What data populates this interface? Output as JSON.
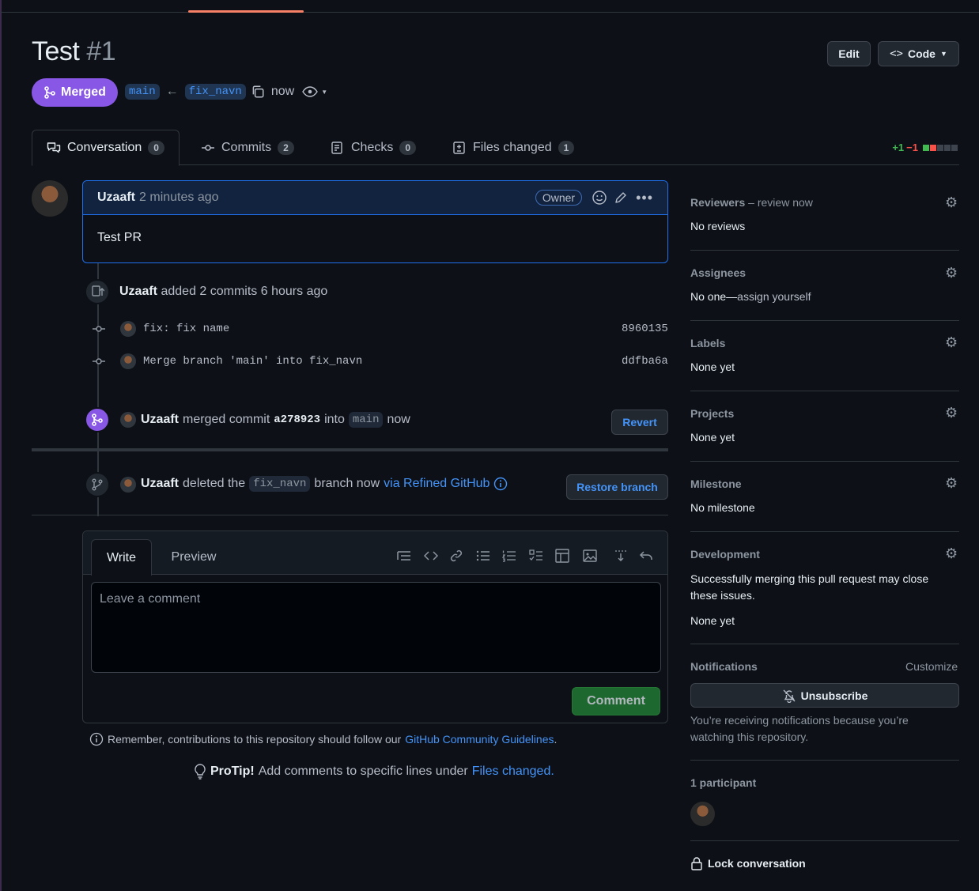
{
  "header": {
    "title": "Test",
    "number": "#1",
    "edit_label": "Edit",
    "code_label": "Code",
    "state_label": "Merged",
    "base_branch": "main",
    "arrow": "←",
    "head_branch": "fix_navn",
    "time": "now"
  },
  "tabs": [
    {
      "label": "Conversation",
      "count": "0"
    },
    {
      "label": "Commits",
      "count": "2"
    },
    {
      "label": "Checks",
      "count": "0"
    },
    {
      "label": "Files changed",
      "count": "1"
    }
  ],
  "diffstat": {
    "additions": "+1",
    "deletions": "−1"
  },
  "comment": {
    "author": "Uzaaft",
    "time": "2 minutes ago",
    "role": "Owner",
    "body": "Test PR"
  },
  "commits_event": {
    "author": "Uzaaft",
    "text": "added 2 commits 6 hours ago",
    "commits": [
      {
        "message": "fix: fix name",
        "sha": "8960135"
      },
      {
        "message": "Merge branch 'main' into fix_navn",
        "sha": "ddfba6a"
      }
    ]
  },
  "merge_event": {
    "author": "Uzaaft",
    "text1": "merged commit",
    "sha": "a278923",
    "text2": "into",
    "branch": "main",
    "time": "now",
    "revert_label": "Revert"
  },
  "delete_event": {
    "author": "Uzaaft",
    "text1": "deleted the",
    "branch": "fix_navn",
    "text2": "branch now",
    "via": "via Refined GitHub",
    "restore_label": "Restore branch"
  },
  "editor": {
    "write_label": "Write",
    "preview_label": "Preview",
    "placeholder": "Leave a comment",
    "submit_label": "Comment"
  },
  "footer": {
    "guidelines_prefix": "Remember, contributions to this repository should follow our",
    "guidelines_link": "GitHub Community Guidelines",
    "guidelines_suffix": ".",
    "protip_label": "ProTip!",
    "protip_text": "Add comments to specific lines under",
    "protip_link": "Files changed",
    "protip_suffix": "."
  },
  "sidebar": {
    "reviewers": {
      "title": "Reviewers",
      "extra": "– review now",
      "value": "No reviews"
    },
    "assignees": {
      "title": "Assignees",
      "value_prefix": "No one—",
      "value_link": "assign yourself"
    },
    "labels": {
      "title": "Labels",
      "value": "None yet"
    },
    "projects": {
      "title": "Projects",
      "value": "None yet"
    },
    "milestone": {
      "title": "Milestone",
      "value": "No milestone"
    },
    "development": {
      "title": "Development",
      "text": "Successfully merging this pull request may close these issues.",
      "value": "None yet"
    },
    "notifications": {
      "title": "Notifications",
      "customize": "Customize",
      "button": "Unsubscribe",
      "note": "You’re receiving notifications because you’re watching this repository."
    },
    "participants": {
      "title": "1 participant"
    },
    "lock": {
      "label": "Lock conversation"
    }
  },
  "colors": {
    "accent": "#8957e5",
    "link": "#4493f8",
    "success": "#238636",
    "danger": "#f85149"
  }
}
